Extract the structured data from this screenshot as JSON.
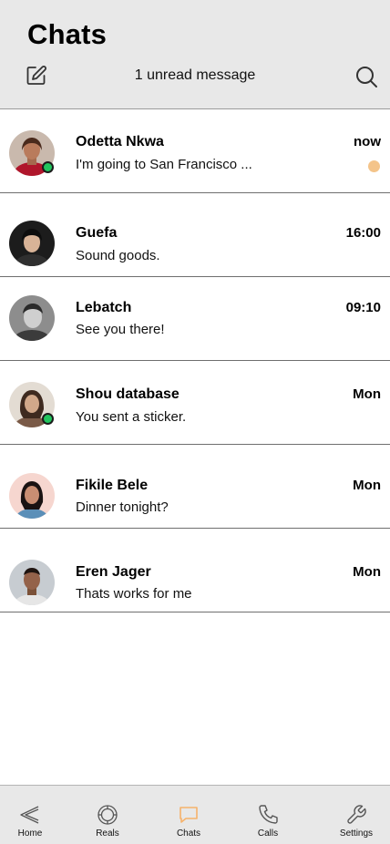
{
  "header": {
    "title": "Chats",
    "unread_text": "1 unread message"
  },
  "chats": [
    {
      "name": "Odetta Nkwa",
      "message": "I'm going to San Francisco ...",
      "time": "now",
      "online": true,
      "unread": true
    },
    {
      "name": "Guefa",
      "message": "Sound goods.",
      "time": "16:00",
      "online": false,
      "unread": false
    },
    {
      "name": "Lebatch",
      "message": "See you there!",
      "time": "09:10",
      "online": false,
      "unread": false
    },
    {
      "name": "Shou database",
      "message": "You sent a sticker.",
      "time": "Mon",
      "online": true,
      "unread": false
    },
    {
      "name": "Fikile Bele",
      "message": "Dinner tonight?",
      "time": "Mon",
      "online": false,
      "unread": false
    },
    {
      "name": "Eren Jager",
      "message": "Thats works for me",
      "time": "Mon",
      "online": false,
      "unread": false
    }
  ],
  "tabs": [
    {
      "label": "Home",
      "icon": "back-arrow-icon",
      "active": false
    },
    {
      "label": "Reals",
      "icon": "reels-icon",
      "active": false
    },
    {
      "label": "Chats",
      "icon": "chat-bubble-icon",
      "active": true
    },
    {
      "label": "Calls",
      "icon": "phone-icon",
      "active": false
    },
    {
      "label": "Settings",
      "icon": "wrench-icon",
      "active": false
    }
  ],
  "colors": {
    "header_bg": "#e8e8e8",
    "unread_dot": "#f4c48a",
    "online_dot": "#22c55e",
    "active_tab": "#f6b26b",
    "inactive_tab": "#555555"
  }
}
